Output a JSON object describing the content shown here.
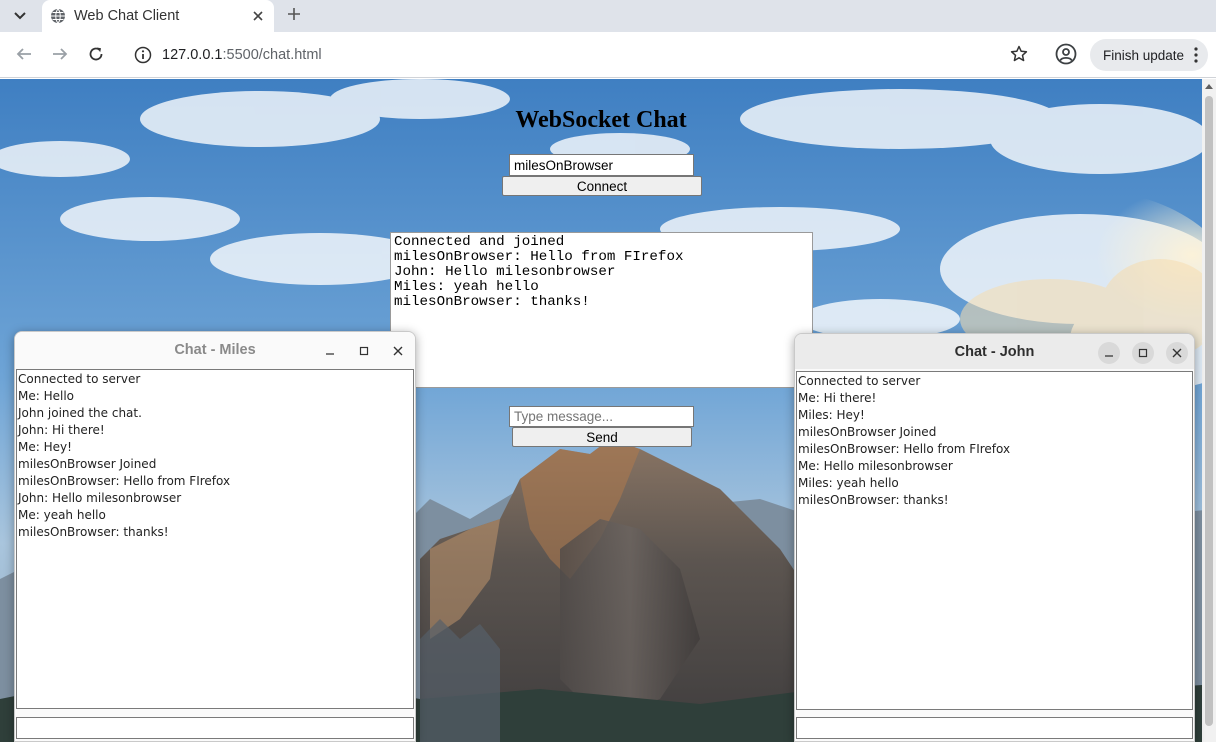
{
  "browser": {
    "tab_title": "Web Chat Client",
    "url_host": "127.0.0.1",
    "url_rest": ":5500/chat.html",
    "finish_update_label": "Finish update"
  },
  "page": {
    "title": "WebSocket Chat",
    "username_value": "milesOnBrowser",
    "connect_label": "Connect",
    "log_lines": [
      "Connected and joined",
      "milesOnBrowser: Hello from FIrefox",
      "John: Hello milesonbrowser",
      "Miles: yeah hello",
      "milesOnBrowser: thanks!"
    ],
    "message_placeholder": "Type message...",
    "send_label": "Send"
  },
  "windows": {
    "miles": {
      "title": "Chat - Miles",
      "lines": [
        "Connected to server",
        "Me: Hello",
        "John joined the chat.",
        "John: Hi there!",
        "Me: Hey!",
        "milesOnBrowser Joined",
        "milesOnBrowser: Hello from FIrefox",
        "John: Hello milesonbrowser",
        "Me: yeah hello",
        "milesOnBrowser: thanks!"
      ]
    },
    "john": {
      "title": "Chat - John",
      "lines": [
        "Connected to server",
        "Me: Hi there!",
        "Miles: Hey!",
        "milesOnBrowser Joined",
        "milesOnBrowser: Hello from FIrefox",
        "Me: Hello milesonbrowser",
        "Miles: yeah hello",
        "milesOnBrowser: thanks!"
      ]
    }
  },
  "icons": {
    "tab_menu": "chevron-down-icon",
    "tab_favicon": "globe-icon",
    "tab_close": "close-icon",
    "new_tab": "plus-icon",
    "back": "back-arrow-icon",
    "forward": "forward-arrow-icon",
    "reload": "reload-icon",
    "site_info": "site-info-icon",
    "bookmark": "star-icon",
    "profile": "profile-icon",
    "menu": "kebab-menu-icon",
    "minimize": "minimize-icon",
    "maximize": "maximize-icon",
    "close": "close-icon"
  },
  "colors": {
    "sky": "#5f9bd4",
    "button_bg": "#efefef",
    "input_border": "#767676"
  }
}
